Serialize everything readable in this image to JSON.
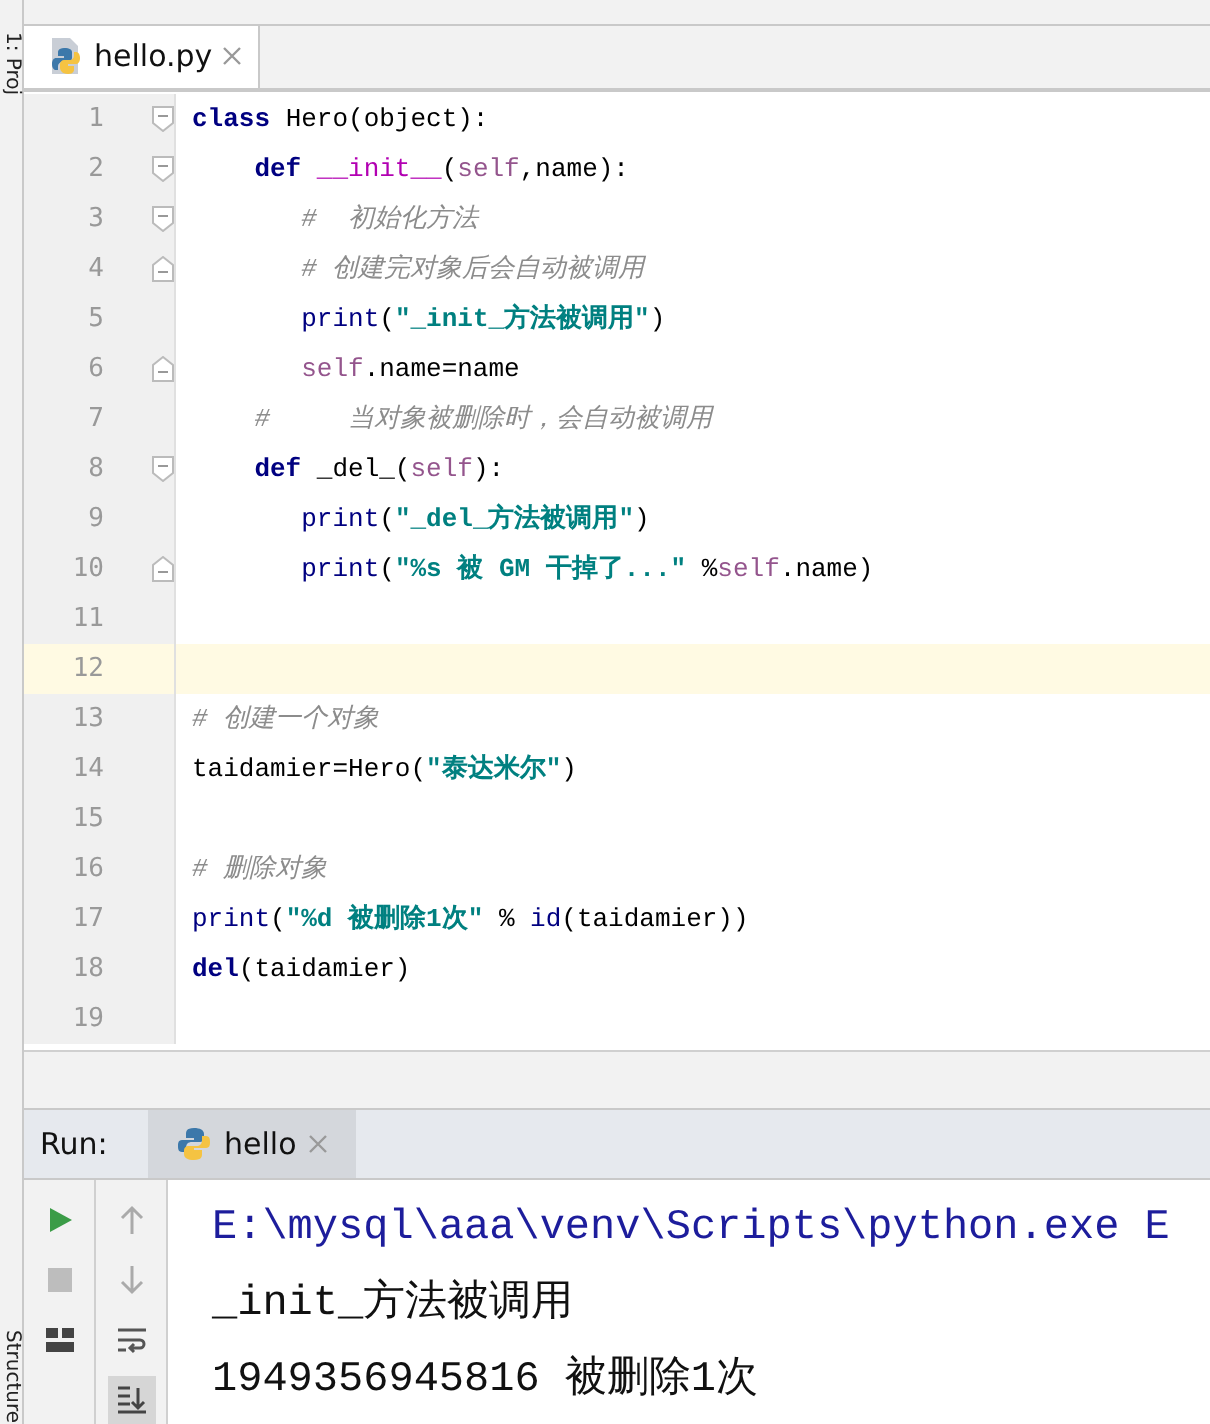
{
  "sidebar": {
    "top_label": "1: Proj",
    "bottom_label": "Structure"
  },
  "editor_tabs": [
    {
      "label": "hello.py",
      "selected": true
    }
  ],
  "code_lines": [
    {
      "number": "1",
      "fold_start": true,
      "fold_end": false,
      "current": false,
      "segments": [
        {
          "kind": "keyword",
          "text": "class"
        },
        {
          "kind": "plain",
          "text": " Hero(object):"
        }
      ]
    },
    {
      "number": "2",
      "fold_start": true,
      "fold_end": false,
      "current": false,
      "segments": [
        {
          "kind": "keyword",
          "text": "    def"
        },
        {
          "kind": "magic",
          "text": " __init__"
        },
        {
          "kind": "plain",
          "text": "("
        },
        {
          "kind": "self",
          "text": "self"
        },
        {
          "kind": "plain",
          "text": ",name):"
        }
      ]
    },
    {
      "number": "3",
      "fold_start": true,
      "fold_end": false,
      "current": false,
      "segments": [
        {
          "kind": "comment",
          "text": "       #  初始化方法"
        }
      ]
    },
    {
      "number": "4",
      "fold_start": false,
      "fold_end": true,
      "current": false,
      "segments": [
        {
          "kind": "comment",
          "text": "       # 创建完对象后会自动被调用"
        }
      ]
    },
    {
      "number": "5",
      "fold_start": false,
      "fold_end": false,
      "current": false,
      "segments": [
        {
          "kind": "builtin",
          "text": "       print"
        },
        {
          "kind": "plain",
          "text": "("
        },
        {
          "kind": "string",
          "text": "\"_init_方法被调用\""
        },
        {
          "kind": "plain",
          "text": ")"
        }
      ]
    },
    {
      "number": "6",
      "fold_start": false,
      "fold_end": true,
      "current": false,
      "segments": [
        {
          "kind": "self",
          "text": "       self"
        },
        {
          "kind": "plain",
          "text": ".name=name"
        }
      ]
    },
    {
      "number": "7",
      "fold_start": false,
      "fold_end": false,
      "current": false,
      "segments": [
        {
          "kind": "comment",
          "text": "    #     当对象被删除时，会自动被调用"
        }
      ]
    },
    {
      "number": "8",
      "fold_start": true,
      "fold_end": false,
      "current": false,
      "segments": [
        {
          "kind": "keyword",
          "text": "    def"
        },
        {
          "kind": "plain",
          "text": " _del_("
        },
        {
          "kind": "self",
          "text": "self"
        },
        {
          "kind": "plain",
          "text": "):"
        }
      ]
    },
    {
      "number": "9",
      "fold_start": false,
      "fold_end": false,
      "current": false,
      "segments": [
        {
          "kind": "builtin",
          "text": "       print"
        },
        {
          "kind": "plain",
          "text": "("
        },
        {
          "kind": "string",
          "text": "\"_del_方法被调用\""
        },
        {
          "kind": "plain",
          "text": ")"
        }
      ]
    },
    {
      "number": "10",
      "fold_start": false,
      "fold_end": true,
      "current": false,
      "segments": [
        {
          "kind": "builtin",
          "text": "       print"
        },
        {
          "kind": "plain",
          "text": "("
        },
        {
          "kind": "string",
          "text": "\"%s 被 GM 干掉了...\""
        },
        {
          "kind": "plain",
          "text": " %"
        },
        {
          "kind": "self",
          "text": "self"
        },
        {
          "kind": "plain",
          "text": ".name)"
        }
      ]
    },
    {
      "number": "11",
      "fold_start": false,
      "fold_end": false,
      "current": false
    },
    {
      "number": "12",
      "fold_start": false,
      "fold_end": false,
      "current": true
    },
    {
      "number": "13",
      "fold_start": false,
      "fold_end": false,
      "current": false,
      "segments": [
        {
          "kind": "comment",
          "text": "# 创建一个对象"
        }
      ]
    },
    {
      "number": "14",
      "fold_start": false,
      "fold_end": false,
      "current": false,
      "segments": [
        {
          "kind": "plain",
          "text": "taidamier=Hero("
        },
        {
          "kind": "string",
          "text": "\"泰达米尔\""
        },
        {
          "kind": "plain",
          "text": ")"
        }
      ]
    },
    {
      "number": "15",
      "fold_start": false,
      "fold_end": false,
      "current": false
    },
    {
      "number": "16",
      "fold_start": false,
      "fold_end": false,
      "current": false,
      "segments": [
        {
          "kind": "comment",
          "text": "# 删除对象"
        }
      ]
    },
    {
      "number": "17",
      "fold_start": false,
      "fold_end": false,
      "current": false,
      "segments": [
        {
          "kind": "builtin",
          "text": "print"
        },
        {
          "kind": "plain",
          "text": "("
        },
        {
          "kind": "string",
          "text": "\"%d 被删除1次\""
        },
        {
          "kind": "plain",
          "text": " % "
        },
        {
          "kind": "builtin",
          "text": "id"
        },
        {
          "kind": "plain",
          "text": "(taidamier))"
        }
      ]
    },
    {
      "number": "18",
      "fold_start": false,
      "fold_end": false,
      "current": false,
      "segments": [
        {
          "kind": "keyword",
          "text": "del"
        },
        {
          "kind": "plain",
          "text": "(taidamier)"
        }
      ]
    },
    {
      "number": "19",
      "fold_start": false,
      "fold_end": false,
      "current": false
    }
  ],
  "run_panel": {
    "label": "Run:",
    "tabs": [
      {
        "label": "hello",
        "selected": true
      }
    ],
    "tools": [
      {
        "kind": "play",
        "selected": false
      },
      {
        "kind": "stop",
        "selected": false
      },
      {
        "kind": "up",
        "selected": false
      },
      {
        "kind": "down",
        "selected": false
      },
      {
        "kind": "wrap",
        "selected": false
      },
      {
        "kind": "layout",
        "selected": false
      },
      {
        "kind": "scroll-end",
        "selected": true
      }
    ],
    "output": [
      {
        "kind": "command",
        "text": "E:\\mysql\\aaa\\venv\\Scripts\\python.exe E"
      },
      {
        "kind": "stdout",
        "text": "_init_方法被调用"
      },
      {
        "kind": "stdout",
        "text": "1949356945816 被删除1次"
      }
    ]
  }
}
